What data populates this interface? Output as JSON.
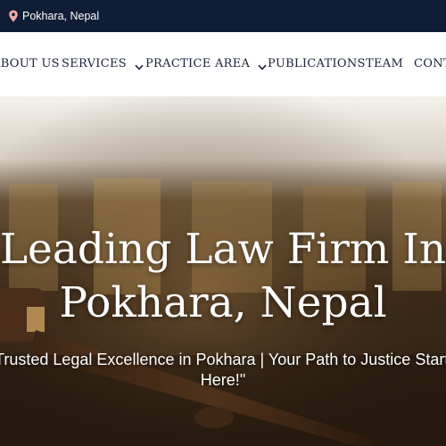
{
  "topbar": {
    "location_icon": "map-pin-icon",
    "location": "Pokhara, Nepal"
  },
  "nav": {
    "items": [
      {
        "label": "ABOUT US",
        "has_dropdown": false
      },
      {
        "label": "SERVICES",
        "has_dropdown": true
      },
      {
        "label": "PRACTICE AREA",
        "has_dropdown": true
      },
      {
        "label": "PUBLICATIONS",
        "has_dropdown": false
      },
      {
        "label": "TEAM",
        "has_dropdown": false
      },
      {
        "label": "CONTACT",
        "has_dropdown": false
      }
    ],
    "dropdown_icon": "chevron-down-icon"
  },
  "hero": {
    "title_line1": "Leading Law Firm In",
    "title_line2": "Pokhara, Nepal",
    "subtitle_line1": "\"Trusted Legal Excellence in Pokhara | Your Path to Justice Starts",
    "subtitle_line2": "Here!\""
  },
  "colors": {
    "topbar_bg": "#0f1e36",
    "nav_text": "#1a2238",
    "pin": "#f3a9a0",
    "hero_text": "#ffffff"
  }
}
